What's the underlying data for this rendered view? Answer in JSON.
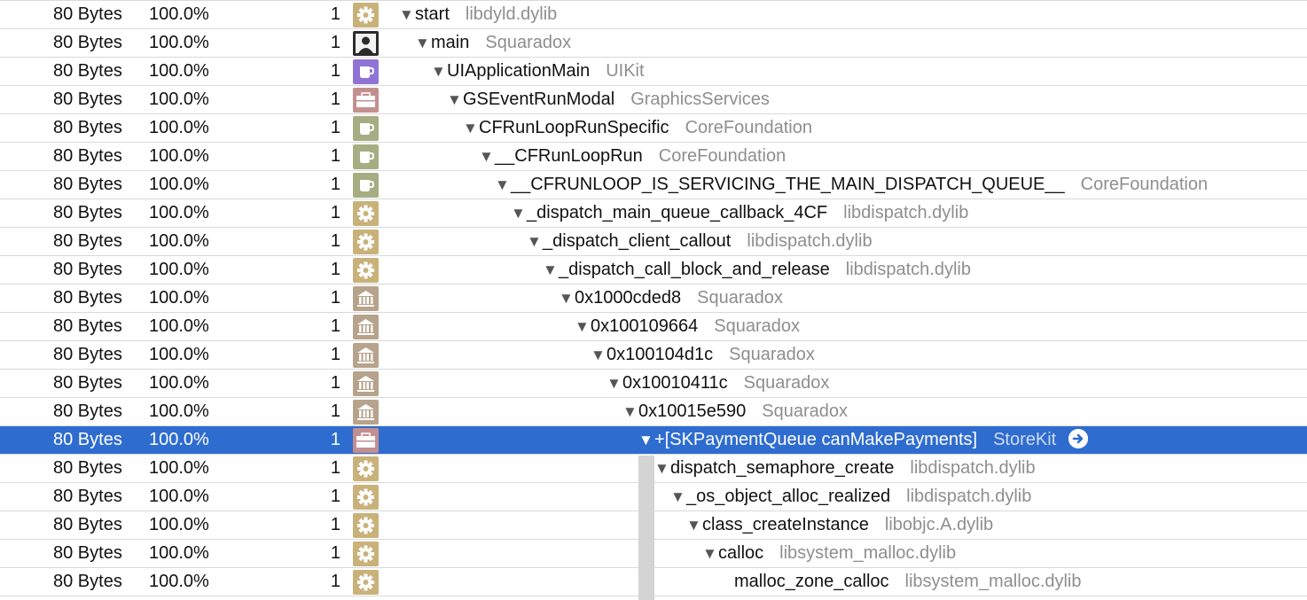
{
  "colors": {
    "selection": "#2f6ccf",
    "library_text": "#8e8e8e",
    "gear_icon_bg": "#c9b27a",
    "person_icon_bg": "#2b2b2b",
    "cup_purple_bg": "#8f74d6",
    "briefcase_bg": "#c48f8f",
    "cup_green_bg": "#a6ad82",
    "building_bg": "#b7a38b"
  },
  "rows": [
    {
      "bytes": "80 Bytes",
      "percent": "100.0%",
      "count": "1",
      "icon": "gear-icon",
      "depth": 0,
      "expanded": true,
      "symbol": "start",
      "library": "libdyld.dylib",
      "selected": false
    },
    {
      "bytes": "80 Bytes",
      "percent": "100.0%",
      "count": "1",
      "icon": "person-icon",
      "depth": 1,
      "expanded": true,
      "symbol": "main",
      "library": "Squaradox",
      "selected": false
    },
    {
      "bytes": "80 Bytes",
      "percent": "100.0%",
      "count": "1",
      "icon": "cup-purple-icon",
      "depth": 2,
      "expanded": true,
      "symbol": "UIApplicationMain",
      "library": "UIKit",
      "selected": false
    },
    {
      "bytes": "80 Bytes",
      "percent": "100.0%",
      "count": "1",
      "icon": "briefcase-icon",
      "depth": 3,
      "expanded": true,
      "symbol": "GSEventRunModal",
      "library": "GraphicsServices",
      "selected": false
    },
    {
      "bytes": "80 Bytes",
      "percent": "100.0%",
      "count": "1",
      "icon": "cup-green-icon",
      "depth": 4,
      "expanded": true,
      "symbol": "CFRunLoopRunSpecific",
      "library": "CoreFoundation",
      "selected": false
    },
    {
      "bytes": "80 Bytes",
      "percent": "100.0%",
      "count": "1",
      "icon": "cup-green-icon",
      "depth": 5,
      "expanded": true,
      "symbol": "__CFRunLoopRun",
      "library": "CoreFoundation",
      "selected": false
    },
    {
      "bytes": "80 Bytes",
      "percent": "100.0%",
      "count": "1",
      "icon": "cup-green-icon",
      "depth": 6,
      "expanded": true,
      "symbol": "__CFRUNLOOP_IS_SERVICING_THE_MAIN_DISPATCH_QUEUE__",
      "library": "CoreFoundation",
      "selected": false
    },
    {
      "bytes": "80 Bytes",
      "percent": "100.0%",
      "count": "1",
      "icon": "gear-icon",
      "depth": 7,
      "expanded": true,
      "symbol": "_dispatch_main_queue_callback_4CF",
      "library": "libdispatch.dylib",
      "selected": false
    },
    {
      "bytes": "80 Bytes",
      "percent": "100.0%",
      "count": "1",
      "icon": "gear-icon",
      "depth": 8,
      "expanded": true,
      "symbol": "_dispatch_client_callout",
      "library": "libdispatch.dylib",
      "selected": false
    },
    {
      "bytes": "80 Bytes",
      "percent": "100.0%",
      "count": "1",
      "icon": "gear-icon",
      "depth": 9,
      "expanded": true,
      "symbol": "_dispatch_call_block_and_release",
      "library": "libdispatch.dylib",
      "selected": false
    },
    {
      "bytes": "80 Bytes",
      "percent": "100.0%",
      "count": "1",
      "icon": "building-icon",
      "depth": 10,
      "expanded": true,
      "symbol": "0x1000cded8",
      "library": "Squaradox",
      "selected": false
    },
    {
      "bytes": "80 Bytes",
      "percent": "100.0%",
      "count": "1",
      "icon": "building-icon",
      "depth": 11,
      "expanded": true,
      "symbol": "0x100109664",
      "library": "Squaradox",
      "selected": false
    },
    {
      "bytes": "80 Bytes",
      "percent": "100.0%",
      "count": "1",
      "icon": "building-icon",
      "depth": 12,
      "expanded": true,
      "symbol": "0x100104d1c",
      "library": "Squaradox",
      "selected": false
    },
    {
      "bytes": "80 Bytes",
      "percent": "100.0%",
      "count": "1",
      "icon": "building-icon",
      "depth": 13,
      "expanded": true,
      "symbol": "0x10010411c",
      "library": "Squaradox",
      "selected": false
    },
    {
      "bytes": "80 Bytes",
      "percent": "100.0%",
      "count": "1",
      "icon": "building-icon",
      "depth": 14,
      "expanded": true,
      "symbol": "0x10015e590",
      "library": "Squaradox",
      "selected": false
    },
    {
      "bytes": "80 Bytes",
      "percent": "100.0%",
      "count": "1",
      "icon": "briefcase-icon",
      "depth": 15,
      "expanded": true,
      "symbol": "+[SKPaymentQueue canMakePayments]",
      "library": "StoreKit",
      "selected": true
    },
    {
      "bytes": "80 Bytes",
      "percent": "100.0%",
      "count": "1",
      "icon": "gear-icon",
      "depth": 16,
      "expanded": true,
      "symbol": "dispatch_semaphore_create",
      "library": "libdispatch.dylib",
      "selected": false
    },
    {
      "bytes": "80 Bytes",
      "percent": "100.0%",
      "count": "1",
      "icon": "gear-icon",
      "depth": 17,
      "expanded": true,
      "symbol": "_os_object_alloc_realized",
      "library": "libdispatch.dylib",
      "selected": false
    },
    {
      "bytes": "80 Bytes",
      "percent": "100.0%",
      "count": "1",
      "icon": "gear-icon",
      "depth": 18,
      "expanded": true,
      "symbol": "class_createInstance",
      "library": "libobjc.A.dylib",
      "selected": false
    },
    {
      "bytes": "80 Bytes",
      "percent": "100.0%",
      "count": "1",
      "icon": "gear-icon",
      "depth": 19,
      "expanded": true,
      "symbol": "calloc",
      "library": "libsystem_malloc.dylib",
      "selected": false
    },
    {
      "bytes": "80 Bytes",
      "percent": "100.0%",
      "count": "1",
      "icon": "gear-icon",
      "depth": 20,
      "expanded": false,
      "symbol": "malloc_zone_calloc",
      "library": "libsystem_malloc.dylib",
      "selected": false
    }
  ]
}
